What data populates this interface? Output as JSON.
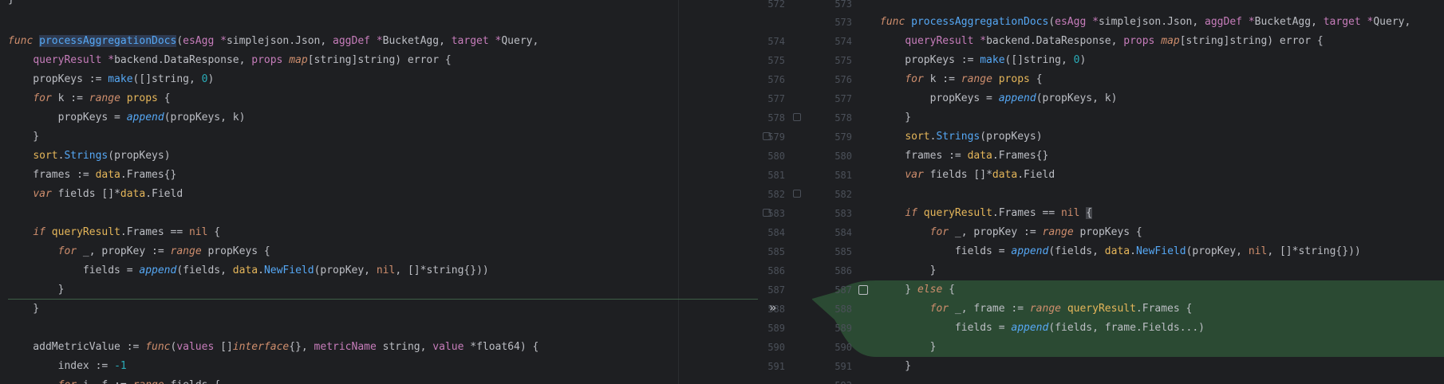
{
  "left": {
    "lines": [
      "}",
      "",
      "func processAggregationDocs(esAgg *simplejson.Json, aggDef *BucketAgg, target *Query,",
      "    queryResult *backend.DataResponse, props map[string]string) error {",
      "    propKeys := make([]string, 0)",
      "    for k := range props {",
      "        propKeys = append(propKeys, k)",
      "    }",
      "    sort.Strings(propKeys)",
      "    frames := data.Frames{}",
      "    var fields []*data.Field",
      "",
      "    if queryResult.Frames == nil {",
      "        for _, propKey := range propKeys {",
      "            fields = append(fields, data.NewField(propKey, nil, []*string{}))",
      "        }",
      "    }",
      "",
      "    addMetricValue := func(values []interface{}, metricName string, value *float64) {",
      "        index := -1",
      "        for i, f := range fields {"
    ]
  },
  "right": {
    "lines": [
      "",
      "func processAggregationDocs(esAgg *simplejson.Json, aggDef *BucketAgg, target *Query,",
      "    queryResult *backend.DataResponse, props map[string]string) error {",
      "    propKeys := make([]string, 0)",
      "    for k := range props {",
      "        propKeys = append(propKeys, k)",
      "    }",
      "    sort.Strings(propKeys)",
      "    frames := data.Frames{}",
      "    var fields []*data.Field",
      "",
      "    if queryResult.Frames == nil {",
      "        for _, propKey := range propKeys {",
      "            fields = append(fields, data.NewField(propKey, nil, []*string{}))",
      "        }",
      "    } else {",
      "        for _, frame := range queryResult.Frames {",
      "            fields = append(fields, frame.Fields...)",
      "        }",
      "    }"
    ]
  },
  "gutter": {
    "left_numbers": [
      "572",
      "574",
      "575",
      "576",
      "577",
      "578",
      "579",
      "580",
      "581",
      "582",
      "583",
      "584",
      "585",
      "586",
      "587",
      "588",
      "589",
      "590",
      "591"
    ],
    "right_numbers": [
      "573",
      "573",
      "574",
      "575",
      "576",
      "577",
      "578",
      "579",
      "580",
      "581",
      "582",
      "583",
      "584",
      "585",
      "586",
      "587",
      "588",
      "589",
      "590",
      "591",
      "592"
    ],
    "current_line": "584"
  },
  "colors": {
    "background": "#1e1f22",
    "change_band": "#2b4a33",
    "keyword": "#cf8e6d",
    "function": "#56a8f5",
    "number": "#2aacb8",
    "param": "#c77dbb",
    "package": "#e5b65a"
  },
  "icons": {
    "apply_change": "double-chevron-right-icon",
    "select_change": "checkbox-icon",
    "fold": "fold-marker-icon"
  }
}
